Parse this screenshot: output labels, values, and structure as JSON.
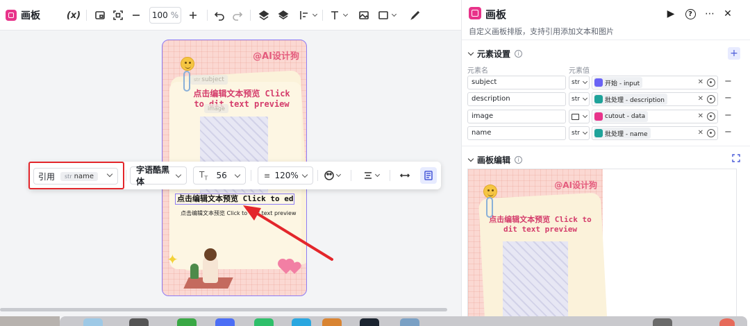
{
  "app": {
    "title": "画板"
  },
  "toolbar": {
    "variable_label": "(x)",
    "zoom_value": "100",
    "zoom_unit": "%"
  },
  "canvas": {
    "poster": {
      "brand": "@AI设计狗",
      "subject_placeholder_type": "str",
      "subject_placeholder": "subject",
      "image_placeholder": "image",
      "title": "点击编辑文本预览 Click to dit text preview",
      "selected_text": "点击编辑文本预览 Click to edi",
      "subtext": "点击编辑文本预览 Click to edit text preview"
    },
    "text_toolbar": {
      "ref_label": "引用",
      "ref_type": "str",
      "ref_value": "name",
      "font_name": "字语酷黑体",
      "font_size": "56",
      "line_height": "120%"
    }
  },
  "panel": {
    "title": "画板",
    "description": "自定义画板排版，支持引用添加文本和图片",
    "element_settings": {
      "header": "元素设置",
      "col_name": "元素名",
      "col_value": "元素值",
      "rows": [
        {
          "name": "subject",
          "type": "str",
          "value": "开始 - input",
          "icon_color": "#6a63f5"
        },
        {
          "name": "description",
          "type": "str",
          "value": "批处理 - description",
          "icon_color": "#1fa39a"
        },
        {
          "name": "image",
          "type": "img",
          "value": "cutout - data",
          "icon_color": "#e8338a"
        },
        {
          "name": "name",
          "type": "str",
          "value": "批处理 - name",
          "icon_color": "#1fa39a"
        }
      ]
    },
    "board_edit": {
      "header": "画板编辑",
      "preview_brand": "@AI设计狗",
      "preview_title": "点击编辑文本预览 Click to dit text preview"
    }
  },
  "colors": {
    "accent": "#e8338a",
    "selection": "#8d7cf5",
    "annotation": "#e3262b"
  }
}
